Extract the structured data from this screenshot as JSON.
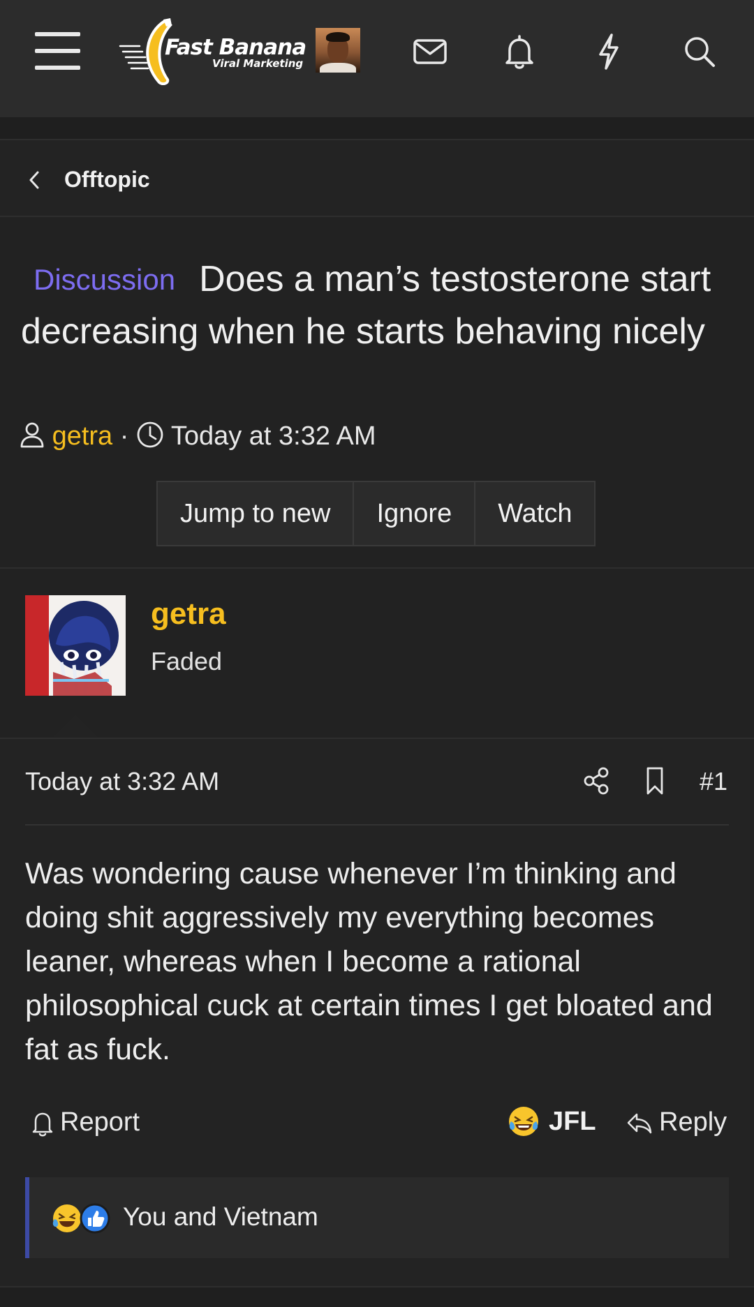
{
  "header": {
    "logo_title": "Fast Banana",
    "logo_subtitle": "Viral Marketing",
    "icons": [
      "menu-icon",
      "mail-icon",
      "bell-icon",
      "lightning-icon",
      "search-icon"
    ]
  },
  "breadcrumb": {
    "label": "Offtopic"
  },
  "thread": {
    "prefix": "Discussion",
    "title": "Does a man’s testosterone start decreasing when he starts behaving nicely",
    "author": "getra",
    "separator": "·",
    "time": "Today at 3:32 AM",
    "buttons": {
      "jump": "Jump to new",
      "ignore": "Ignore",
      "watch": "Watch"
    }
  },
  "post": {
    "username": "getra",
    "user_title": "Faded",
    "date": "Today at 3:32 AM",
    "number": "#1",
    "message": "Was wondering cause whenever I’m thinking and doing shit aggressively my everything becomes leaner, whereas when I become a rational philosophical cuck at certain times I get bloated and fat as fuck.",
    "report_label": "Report",
    "reaction_label": "JFL",
    "reply_label": "Reply",
    "reactions_summary": "You and Vietnam"
  },
  "colors": {
    "background": "#232323",
    "header": "#2c2c2c",
    "prefix": "#7d6df1",
    "username": "#f6be1f",
    "reaction_accent": "#3d4aa5"
  }
}
